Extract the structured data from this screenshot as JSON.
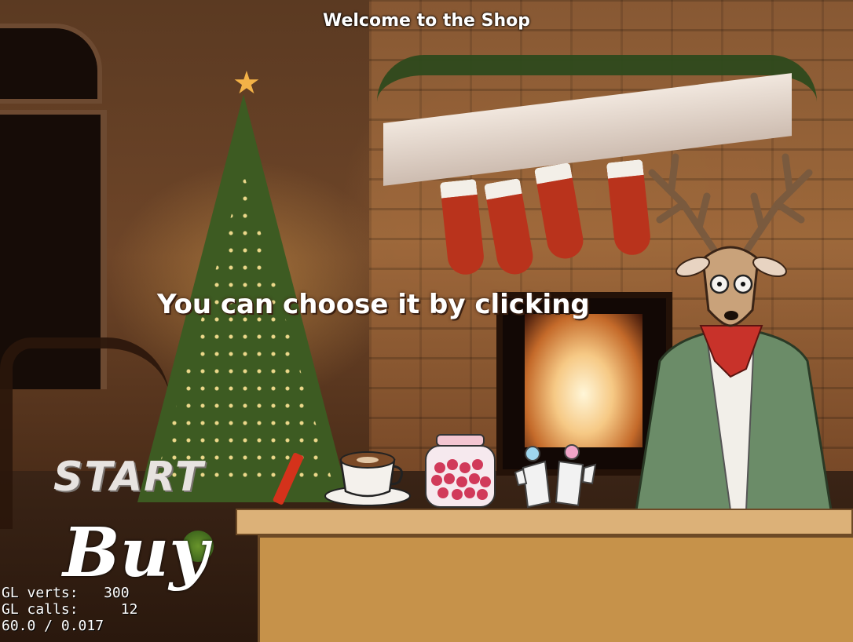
{
  "header": {
    "title": "Welcome to the Shop"
  },
  "hint": {
    "text": "You can choose it by clicking"
  },
  "menu": {
    "start_label": "START",
    "buy_label": "Buy"
  },
  "shop_items": [
    {
      "name": "candle-stick",
      "icon": "candle-icon"
    },
    {
      "name": "coffee-cup",
      "icon": "coffee-cup-icon"
    },
    {
      "name": "candy-jar",
      "icon": "candy-jar-icon"
    },
    {
      "name": "mittens",
      "icon": "mittens-icon"
    }
  ],
  "shopkeeper": {
    "icon": "deer-shopkeeper"
  },
  "debug_stats": {
    "gl_verts_label": "GL verts:",
    "gl_verts": "300",
    "gl_calls_label": "GL calls:",
    "gl_calls": "12",
    "fps_line": "60.0 / 0.017"
  },
  "colors": {
    "counter_top": "#dcb178",
    "counter_front": "#c6924a",
    "stocking_red": "#b9331c",
    "deer_coat": "#6b8c68",
    "scarf_red": "#c8322a"
  }
}
